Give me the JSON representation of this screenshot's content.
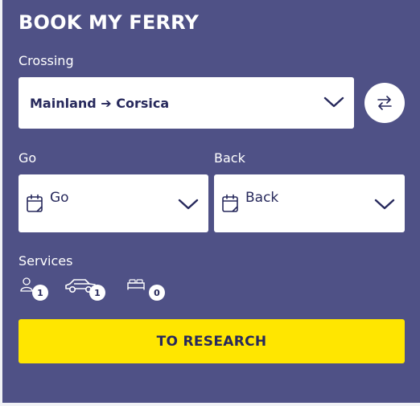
{
  "booking": {
    "title": "BOOK MY FERRY",
    "crossing_label": "Crossing",
    "crossing_value": "Mainland ➔ Corsica",
    "go_label": "Go",
    "go_placeholder": "Go",
    "back_label": "Back",
    "back_placeholder": "Back",
    "services_label": "Services",
    "services": {
      "passengers": "1",
      "vehicles": "1",
      "cabins": "0"
    },
    "search_button": "TO RESEARCH"
  },
  "colors": {
    "panel_bg": "#4f5186",
    "accent_button": "#ffe600",
    "text_dark": "#27295c"
  },
  "icons": [
    "swap-icon",
    "calendar-icon",
    "chevron-down-icon",
    "person-icon",
    "car-icon",
    "bed-icon"
  ]
}
